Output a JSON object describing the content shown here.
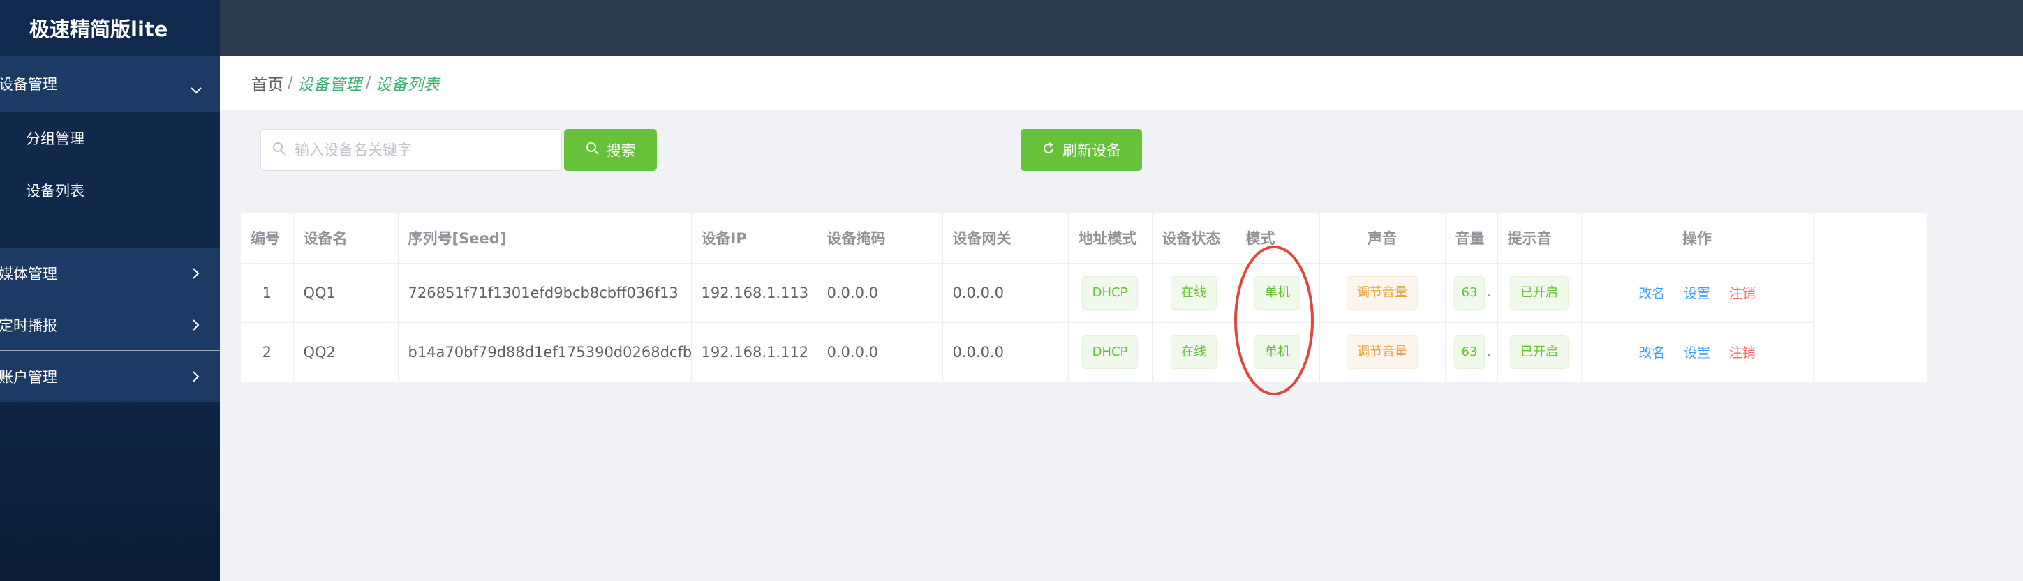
{
  "app": {
    "title": "极速精简版lite"
  },
  "sidebar": {
    "items": [
      {
        "label": "设备管理",
        "expanded": true,
        "children": [
          {
            "label": "分组管理"
          },
          {
            "label": "设备列表"
          }
        ]
      },
      {
        "label": "媒体管理"
      },
      {
        "label": "定时播报"
      },
      {
        "label": "账户管理"
      }
    ]
  },
  "breadcrumb": {
    "home": "首页",
    "sep": "/",
    "items": [
      "设备管理",
      "设备列表"
    ]
  },
  "toolbar": {
    "search_placeholder": "输入设备名关键字",
    "search_value": "",
    "search_button": "搜索",
    "refresh_button": "刷新设备"
  },
  "table": {
    "columns": [
      "编号",
      "设备名",
      "序列号[Seed]",
      "设备IP",
      "设备掩码",
      "设备网关",
      "地址模式",
      "设备状态",
      "模式",
      "声音",
      "音量",
      "提示音",
      "操作"
    ],
    "rows": [
      {
        "id": "1",
        "name": "QQ1",
        "seed": "726851f71f1301efd9bcb8cbff036f13",
        "ip": "192.168.1.113",
        "mask": "0.0.0.0",
        "gateway": "0.0.0.0",
        "addr_mode": "DHCP",
        "status": "在线",
        "mode": "单机",
        "sound": "调节音量",
        "volume": "63",
        "volume_suffix": ".",
        "prompt": "已开启",
        "ops": [
          "改名",
          "设置",
          "注销"
        ]
      },
      {
        "id": "2",
        "name": "QQ2",
        "seed": "b14a70bf79d88d1ef175390d0268dcfb",
        "ip": "192.168.1.112",
        "mask": "0.0.0.0",
        "gateway": "0.0.0.0",
        "addr_mode": "DHCP",
        "status": "在线",
        "mode": "单机",
        "sound": "调节音量",
        "volume": "63",
        "volume_suffix": ".",
        "prompt": "已开启",
        "ops": [
          "改名",
          "设置",
          "注销"
        ]
      }
    ]
  },
  "colors": {
    "accent_green": "#67c23a",
    "link_blue": "#409eff",
    "danger_red": "#f56c6c",
    "warning_orange": "#e6a23c",
    "annotation_red": "#e0473f"
  }
}
